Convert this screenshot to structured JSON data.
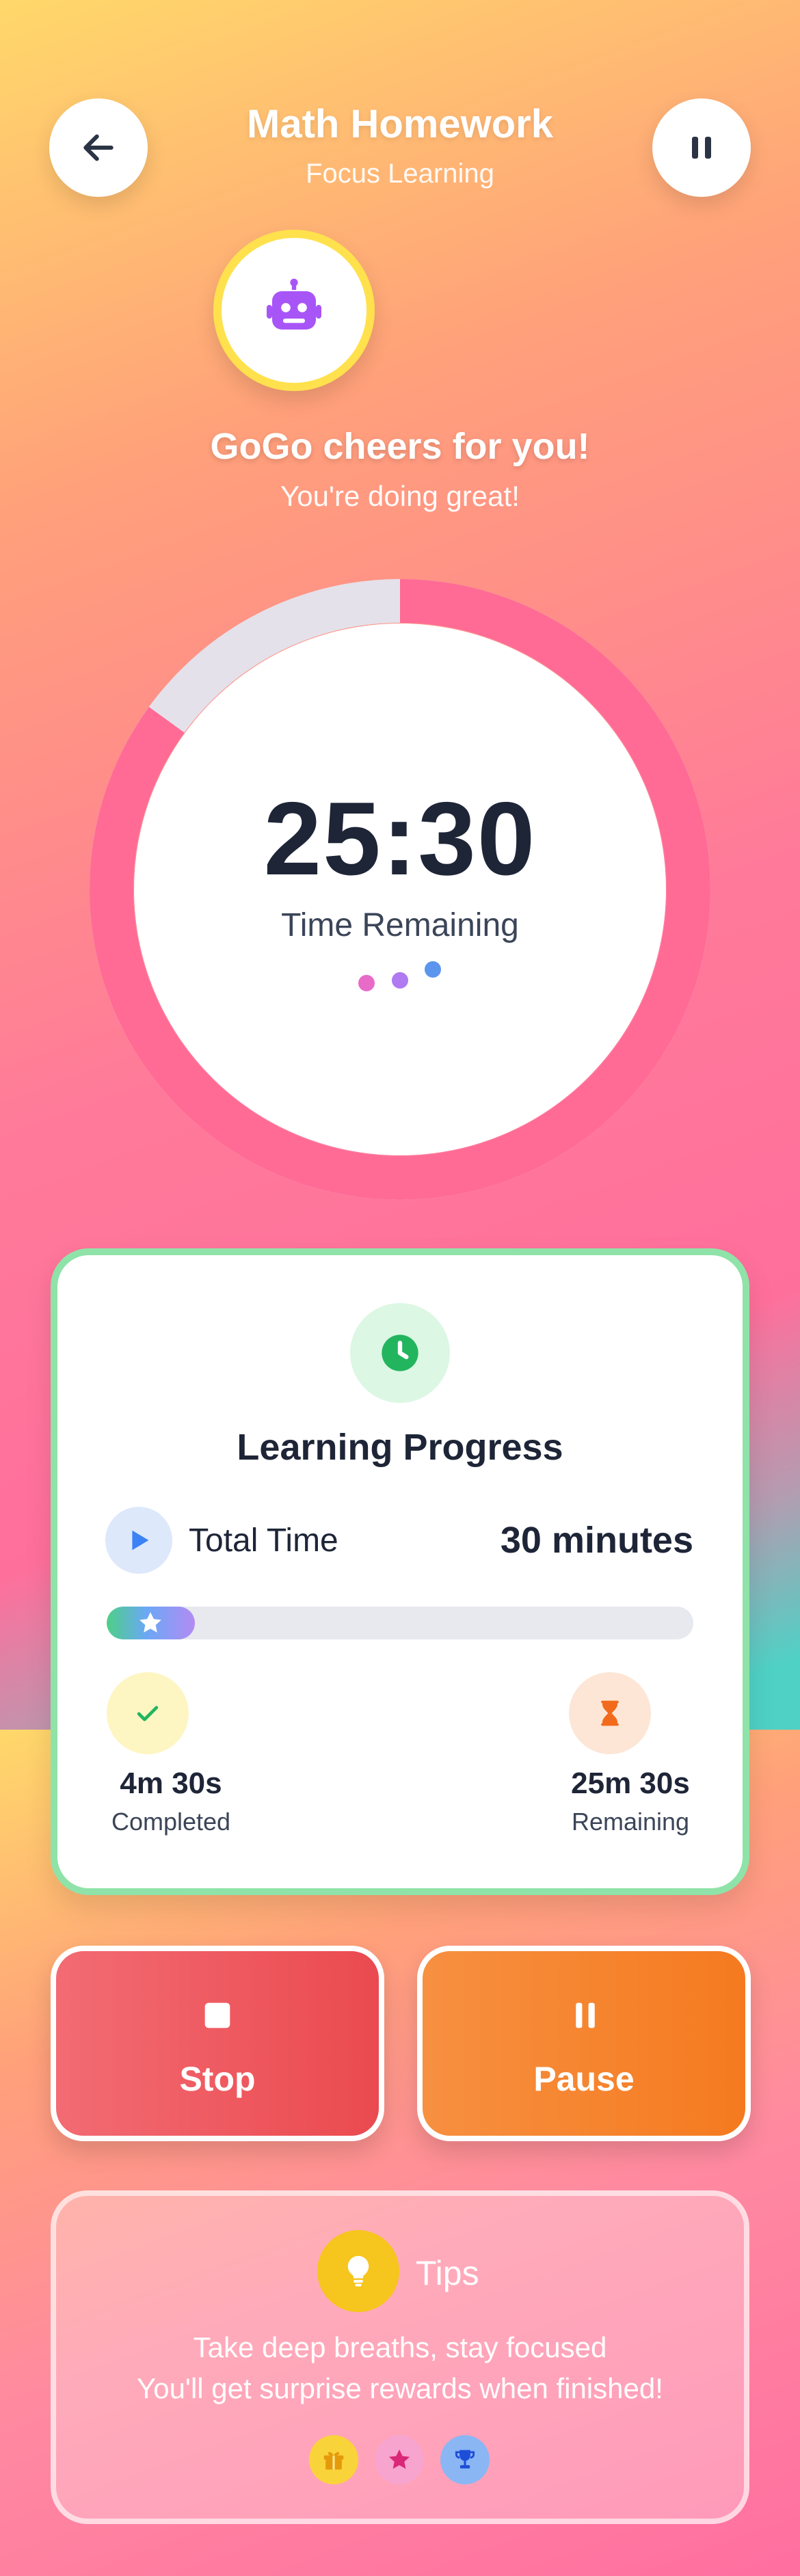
{
  "header": {
    "title": "Math Homework",
    "subtitle": "Focus Learning",
    "back_icon": "arrow-left-icon",
    "pause_icon": "pause-icon"
  },
  "mascot": {
    "icon": "robot-icon",
    "cheer": "GoGo cheers for you!",
    "message": "You're doing great!"
  },
  "timer": {
    "time": "25:30",
    "label": "Time Remaining",
    "progress_fraction": 0.15,
    "colors": {
      "remaining": "#ff6b95",
      "elapsed": "#e5e1ea"
    }
  },
  "progress_card": {
    "title": "Learning Progress",
    "total_label": "Total Time",
    "total_value": "30 minutes",
    "bar_fraction": 0.15,
    "completed": {
      "value": "4m 30s",
      "label": "Completed"
    },
    "remaining": {
      "value": "25m 30s",
      "label": "Remaining"
    }
  },
  "actions": {
    "stop_label": "Stop",
    "pause_label": "Pause"
  },
  "tips": {
    "title": "Tips",
    "line1": "Take deep breaths, stay focused",
    "line2": "You'll get surprise rewards when finished!",
    "badges": [
      "gift-icon",
      "star-icon",
      "trophy-icon"
    ]
  },
  "colors": {
    "accent_pink": "#ff6b95",
    "card_border": "#8fe3a8",
    "stop": "#ea4a4f",
    "pause": "#f57a1f"
  }
}
